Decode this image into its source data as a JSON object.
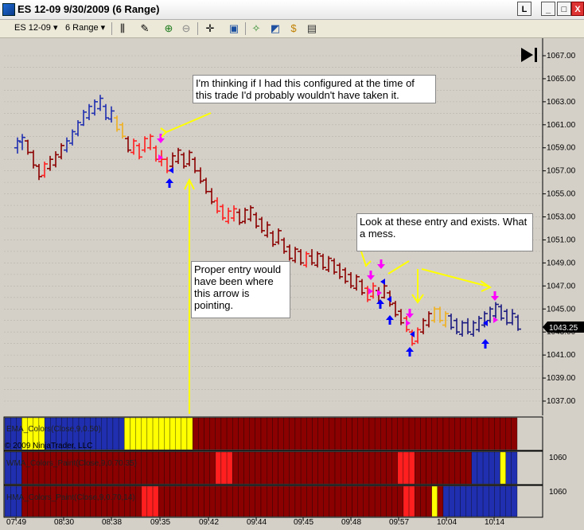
{
  "window": {
    "title": "ES 12-09  9/30/2009 (6 Range)",
    "btn_restore_small": "L",
    "btn_minimize": "_",
    "btn_maximize": "□",
    "btn_close": "X"
  },
  "toolbar": {
    "instrument": "ES 12-09",
    "period": "6 Range"
  },
  "price_axis": [
    "1067.00",
    "1065.00",
    "1063.00",
    "1061.00",
    "1059.00",
    "1057.00",
    "1055.00",
    "1053.00",
    "1051.00",
    "1049.00",
    "1047.00",
    "1045.00",
    "1043.00",
    "1041.00",
    "1039.00",
    "1037.00"
  ],
  "current_price": "1043.25",
  "time_axis": [
    "07:49",
    "08:30",
    "08:38",
    "09:35",
    "09:42",
    "09:44",
    "09:45",
    "09:48",
    "09:57",
    "10:04",
    "10:14"
  ],
  "annotations": {
    "note1": "I'm thinking if I had this configured at the time of this trade I'd probably wouldn't have taken it.",
    "note2": "Look at these entry and exists. What a mess.",
    "note3": "Proper entry would have been where this arrow is pointing."
  },
  "copyright": "© 2009 NinjaTrader, LLC",
  "panels": {
    "panel1_label": "EMA_Colors(Close,9,0.50)",
    "panel2_label": "WMA_Colors_Paint(Close,9,0.70,35)",
    "panel3_label": "HMA_Colors_Paint(Close,9,0.70,14)",
    "panel2_axis": "1060",
    "panel3_axis": "1060"
  },
  "colors": {
    "bull": "#1f2fb0",
    "bear": "#8b0000",
    "red": "#ff1f1f",
    "neutral": "#f0b020",
    "navy": "#1a1a80",
    "yellow": "#ffff00",
    "magenta": "#ff00ff",
    "blue_arrow": "#0000ff",
    "annotation": "#ffff00"
  }
}
